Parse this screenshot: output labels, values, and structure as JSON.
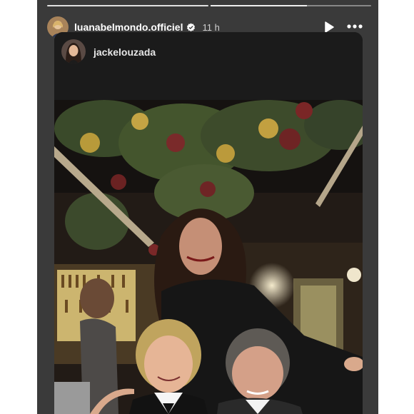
{
  "story": {
    "username": "luanabelmondo.officiel",
    "time": "11 h",
    "progress": {
      "segments": 2,
      "current": 1,
      "current_fill": 0.6
    }
  },
  "shared_post": {
    "username": "jackelouzada"
  },
  "icons": {
    "verified": "verified-badge-icon",
    "play": "play-icon",
    "more": "more-options-icon"
  },
  "colors": {
    "story_bg": "#3a3a3a",
    "card_bg": "#141414",
    "text": "#ffffff"
  }
}
